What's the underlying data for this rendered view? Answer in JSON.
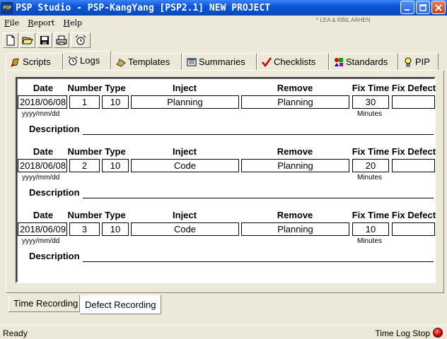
{
  "window": {
    "icon_text": "PSP",
    "title": "PSP Studio - PSP-KangYang [PSP2.1] NEW PROJECT",
    "menu_ghost": "* LEA & RBIL AAHEN"
  },
  "menu": [
    "File",
    "Report",
    "Help"
  ],
  "toolbar": [
    "new-icon",
    "open-icon",
    "save-icon",
    "print-icon",
    "timer-icon"
  ],
  "tabs": [
    {
      "label": "Scripts",
      "icon": "scripts-icon",
      "active": false
    },
    {
      "label": "Logs",
      "icon": "logs-icon",
      "active": true
    },
    {
      "label": "Templates",
      "icon": "templates-icon",
      "active": false
    },
    {
      "label": "Summaries",
      "icon": "summaries-icon",
      "active": false
    },
    {
      "label": "Checklists",
      "icon": "checkmark-icon",
      "active": false
    },
    {
      "label": "Standards",
      "icon": "standards-icon",
      "active": false
    },
    {
      "label": "PIP",
      "icon": "lightbulb-icon",
      "active": false
    }
  ],
  "headers": {
    "date": "Date",
    "number": "Number",
    "type": "Type",
    "inject": "Inject",
    "remove": "Remove",
    "fix_time": "Fix Time",
    "fix_defect": "Fix Defect",
    "date_hint": "yyyy/mm/dd",
    "minutes": "Minutes",
    "description": "Description"
  },
  "defects": [
    {
      "date": "2018/06/08",
      "number": "1",
      "type": "10",
      "inject": "Planning",
      "remove": "Planning",
      "fix_time": "30",
      "fix_defect": "",
      "description": ""
    },
    {
      "date": "2018/06/08",
      "number": "2",
      "type": "10",
      "inject": "Code",
      "remove": "Planning",
      "fix_time": "20",
      "fix_defect": "",
      "description": ""
    },
    {
      "date": "2018/06/09",
      "number": "3",
      "type": "10",
      "inject": "Code",
      "remove": "Planning",
      "fix_time": "10",
      "fix_defect": "",
      "description": ""
    }
  ],
  "bottom_tabs": [
    {
      "label": "Time Recording",
      "active": false
    },
    {
      "label": "Defect Recording",
      "active": true
    }
  ],
  "status": {
    "left": "Ready",
    "right": "Time Log Stop"
  }
}
